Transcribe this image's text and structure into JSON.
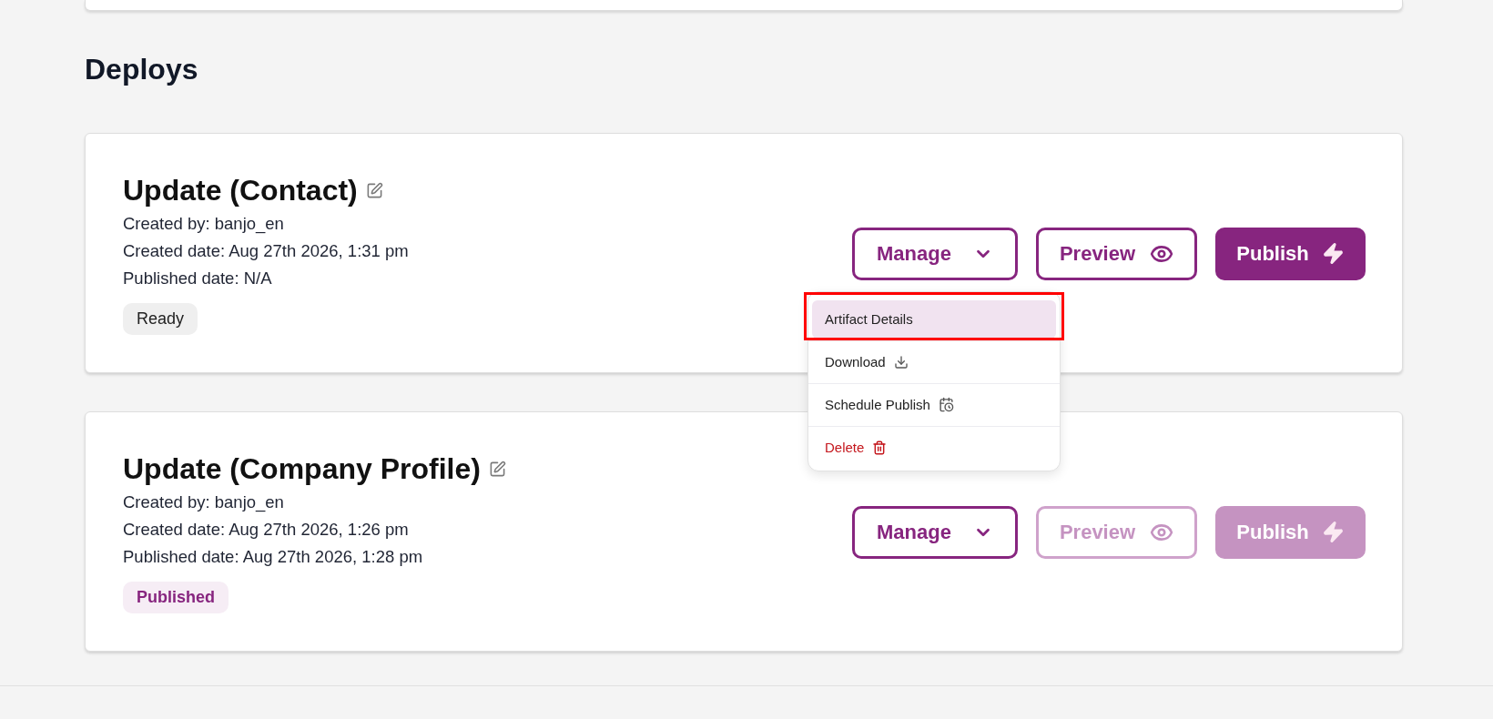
{
  "section_title": "Deploys",
  "deploys": [
    {
      "title": "Update (Contact)",
      "details": [
        "Created by: banjo_en",
        "Created date: Aug 27th 2026, 1:31 pm",
        "Published date: N/A"
      ],
      "status": {
        "label": "Ready",
        "kind": "ready"
      },
      "actions": [
        {
          "label": "Manage",
          "kind": "dropdown",
          "disabled": false
        },
        {
          "label": "Preview",
          "kind": "preview",
          "disabled": false
        },
        {
          "label": "Publish",
          "kind": "publish",
          "disabled": false
        }
      ],
      "menu": {
        "items": [
          {
            "label": "Artifact Details",
            "kind": "details",
            "selected": true,
            "annotated": true
          },
          {
            "label": "Download",
            "kind": "download",
            "selected": false,
            "annotated": false
          },
          {
            "label": "Schedule Publish",
            "kind": "schedule",
            "selected": false,
            "annotated": false
          },
          {
            "label": "Delete",
            "kind": "delete",
            "selected": false,
            "annotated": false
          }
        ]
      }
    },
    {
      "title": "Update (Company Profile)",
      "details": [
        "Created by: banjo_en",
        "Created date: Aug 27th 2026, 1:26 pm",
        "Published date: Aug 27th 2026, 1:28 pm"
      ],
      "status": {
        "label": "Published",
        "kind": "published"
      },
      "actions": [
        {
          "label": "Manage",
          "kind": "dropdown",
          "disabled": false
        },
        {
          "label": "Preview",
          "kind": "preview",
          "disabled": true
        },
        {
          "label": "Publish",
          "kind": "publish",
          "disabled": true
        }
      ]
    }
  ]
}
